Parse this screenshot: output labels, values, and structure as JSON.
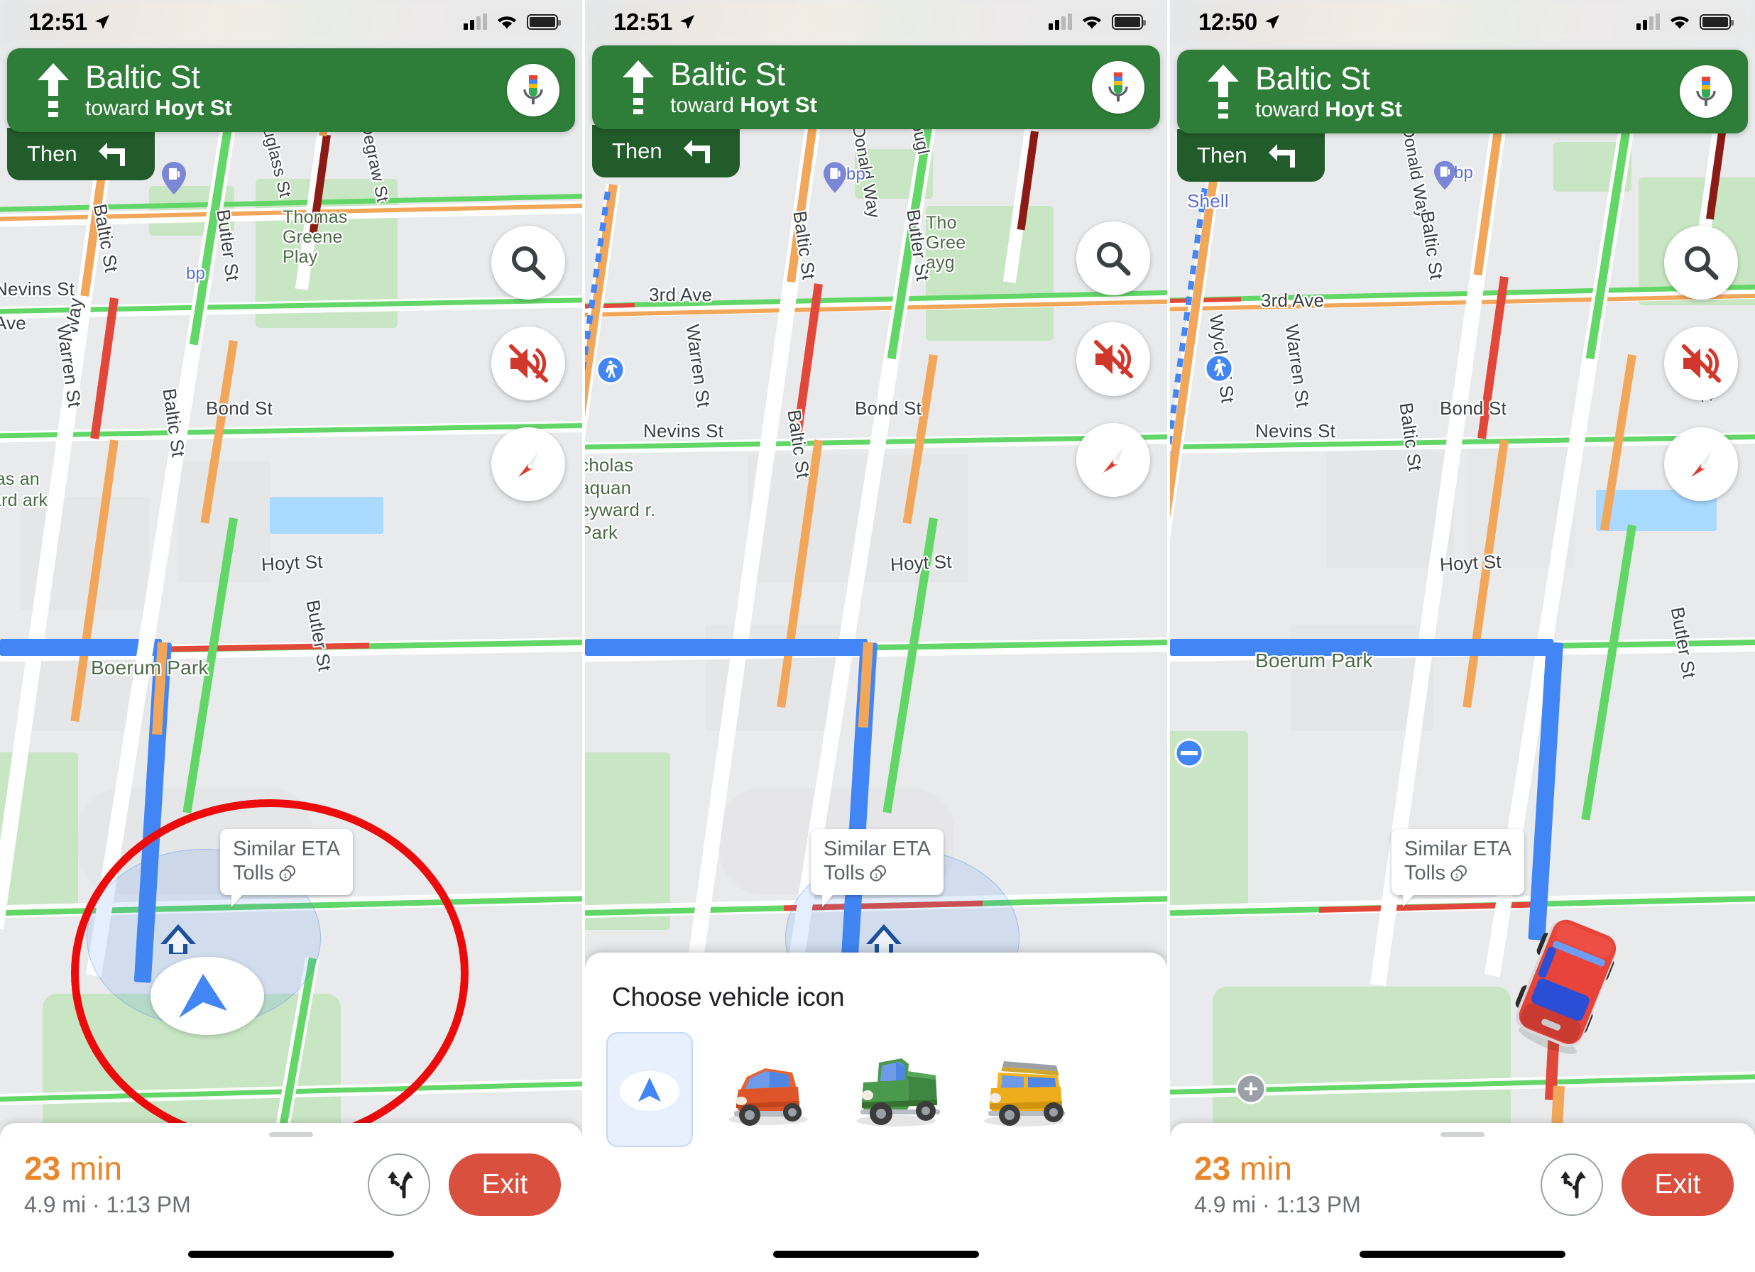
{
  "app": {
    "name": "Google Maps Navigation"
  },
  "panels": [
    {
      "id": "panel-1",
      "status": {
        "time": "12:51",
        "location_arrow": "navigation-arrow-icon",
        "signal": "cellular-signal-icon",
        "wifi": "wifi-icon",
        "battery": "battery-icon"
      },
      "banner": {
        "maneuver_icon": "straight-arrow-icon",
        "street": "Baltic St",
        "toward_prefix": "toward ",
        "toward_street": "Hoyt St",
        "mic_icon": "microphone-icon"
      },
      "then": {
        "label": "Then",
        "icon": "turn-left-arrow-icon"
      },
      "controls": {
        "search": "search-icon",
        "mute": "volume-muted-icon",
        "compass": "compass-icon"
      },
      "callout": {
        "line1": "Similar ETA",
        "line2": "Tolls",
        "icon": "coins-icon"
      },
      "sheet": {
        "eta_value": "23",
        "eta_unit": " min",
        "details": "4.9 mi · 1:13 PM",
        "route_icon": "alternate-routes-icon",
        "exit_label": "Exit"
      },
      "map_labels": [
        "Way",
        "Ave",
        "Baltic St",
        "bp",
        "Douglass St",
        "Degraw St",
        "Thomas Greene Playground",
        "Butler St",
        "Nevins St",
        "Warren St",
        "Bond St",
        "Hoyt St",
        "Boerum Park",
        "Butler St",
        "Nicholas Naquan Heyward Jr. Park"
      ],
      "highlight": {
        "shape": "ellipse",
        "color": "#EC0B0B",
        "target": "vehicle-puck"
      }
    },
    {
      "id": "panel-2",
      "status": {
        "time": "12:51",
        "location_arrow": "navigation-arrow-icon",
        "signal": "cellular-signal-icon",
        "wifi": "wifi-icon",
        "battery": "battery-icon"
      },
      "banner": {
        "maneuver_icon": "straight-arrow-icon",
        "street": "Baltic St",
        "toward_prefix": "toward ",
        "toward_street": "Hoyt St",
        "mic_icon": "microphone-icon"
      },
      "then": {
        "label": "Then",
        "icon": "turn-left-arrow-icon"
      },
      "controls": {
        "search": "search-icon",
        "mute": "volume-muted-icon",
        "compass": "compass-icon"
      },
      "callout": {
        "line1": "Similar ETA",
        "line2": "Tolls",
        "icon": "coins-icon"
      },
      "vehicle_picker": {
        "title": "Choose vehicle icon",
        "options": [
          {
            "name": "arrow",
            "label": "Navigation arrow",
            "selected": true,
            "color": "#4285f4"
          },
          {
            "name": "sedan",
            "label": "Red sedan",
            "selected": false,
            "color": "#e0592a"
          },
          {
            "name": "pickup",
            "label": "Green pickup truck",
            "selected": false,
            "color": "#3e8e41"
          },
          {
            "name": "suv",
            "label": "Yellow SUV",
            "selected": false,
            "color": "#f0b323"
          }
        ]
      },
      "map_labels": [
        "3rd Ave",
        "Willie McDonald Way",
        "Baltic St",
        "bp",
        "Butler St",
        "Nevins St",
        "Warren St",
        "Bond St",
        "Hoyt St",
        "Nicholas Naquan Heyward Jr. Park",
        "Thomas Greene Playground",
        "Dougl"
      ]
    },
    {
      "id": "panel-3",
      "status": {
        "time": "12:50",
        "location_arrow": "navigation-arrow-icon",
        "signal": "cellular-signal-icon",
        "wifi": "wifi-icon",
        "battery": "battery-icon"
      },
      "banner": {
        "maneuver_icon": "straight-arrow-icon",
        "street": "Baltic St",
        "toward_prefix": "toward ",
        "toward_street": "Hoyt St",
        "mic_icon": "microphone-icon"
      },
      "then": {
        "label": "Then",
        "icon": "turn-left-arrow-icon"
      },
      "controls": {
        "search": "search-icon",
        "mute": "volume-muted-icon",
        "compass": "compass-icon"
      },
      "callout": {
        "line1": "Similar ETA",
        "line2": "Tolls",
        "icon": "coins-icon"
      },
      "sheet": {
        "eta_value": "23",
        "eta_unit": " min",
        "details": "4.9 mi · 1:13 PM",
        "route_icon": "alternate-routes-icon",
        "exit_label": "Exit"
      },
      "map_labels": [
        "Shell",
        "3rd Ave",
        "Willie McDonald Way",
        "Baltic St",
        "bp",
        "Wyckoff St",
        "Nevins St",
        "Warren St",
        "Butler St",
        "Bond St",
        "Hoyt St",
        "Boerum Park",
        "Butler St"
      ],
      "vehicle_marker": {
        "name": "red-sedan-marker",
        "color": "#e8443a"
      }
    }
  ],
  "colors": {
    "banner_green": "#2E7D38",
    "then_green": "#225C2A",
    "eta_orange": "#E8862A",
    "exit_red": "#D9503F",
    "route_blue": "#4285F4",
    "highlight_red": "#EC0B0B",
    "traffic_green": "#63D668",
    "traffic_orange": "#F2A65A",
    "traffic_red": "#E2483A",
    "traffic_darkred": "#8B1B14",
    "selected_bg": "#E8F0FE"
  }
}
